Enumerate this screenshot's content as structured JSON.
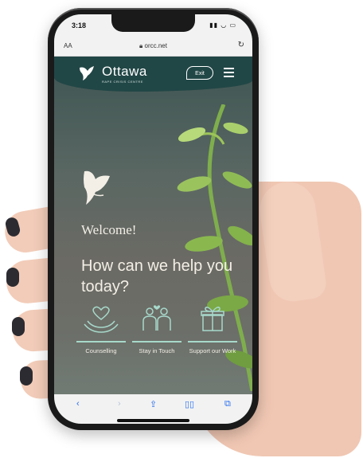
{
  "status": {
    "time": "3:18"
  },
  "browser": {
    "text_size": "AA",
    "url": "orcc.net"
  },
  "header": {
    "logo_name": "Ottawa",
    "logo_sub": "RAPE CRISIS CENTRE",
    "exit_label": "Exit"
  },
  "hero": {
    "welcome": "Welcome!",
    "question": "How can we help you today?"
  },
  "services": [
    {
      "label": "Counselling"
    },
    {
      "label": "Stay in Touch"
    },
    {
      "label": "Support our Work"
    }
  ],
  "colors": {
    "header_bg": "#214646",
    "accent_line": "#a7d9cb",
    "text_light": "#f3efe6"
  }
}
